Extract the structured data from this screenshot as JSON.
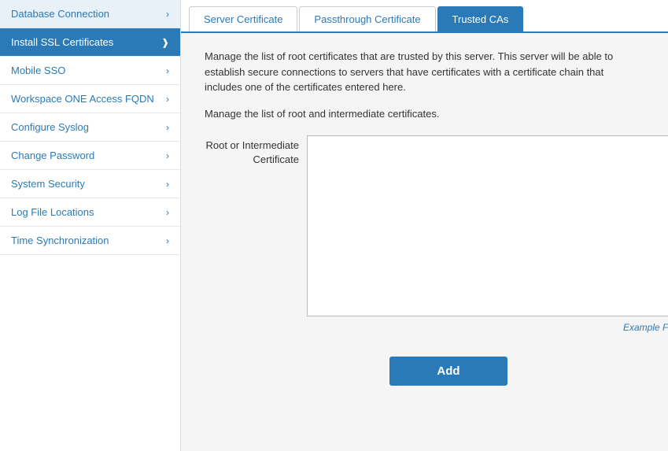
{
  "sidebar": {
    "items": [
      {
        "label": "Database Connection",
        "active": false
      },
      {
        "label": "Install SSL Certificates",
        "active": true
      },
      {
        "label": "Mobile SSO",
        "active": false
      },
      {
        "label": "Workspace ONE Access FQDN",
        "active": false
      },
      {
        "label": "Configure Syslog",
        "active": false
      },
      {
        "label": "Change Password",
        "active": false
      },
      {
        "label": "System Security",
        "active": false
      },
      {
        "label": "Log File Locations",
        "active": false
      },
      {
        "label": "Time Synchronization",
        "active": false
      }
    ]
  },
  "tabs": [
    {
      "label": "Server Certificate",
      "active": false
    },
    {
      "label": "Passthrough Certificate",
      "active": false
    },
    {
      "label": "Trusted CAs",
      "active": true
    }
  ],
  "content": {
    "description1": "Manage the list of root certificates that are trusted by this server. This server will be able to establish secure connections to servers that have certificates with a certificate chain that includes one of the certificates entered here.",
    "description2": "Manage the list of root and intermediate certificates.",
    "form_label": "Root or Intermediate Certificate",
    "textarea_placeholder": "",
    "example_link": "Example Format",
    "add_button": "Add"
  }
}
